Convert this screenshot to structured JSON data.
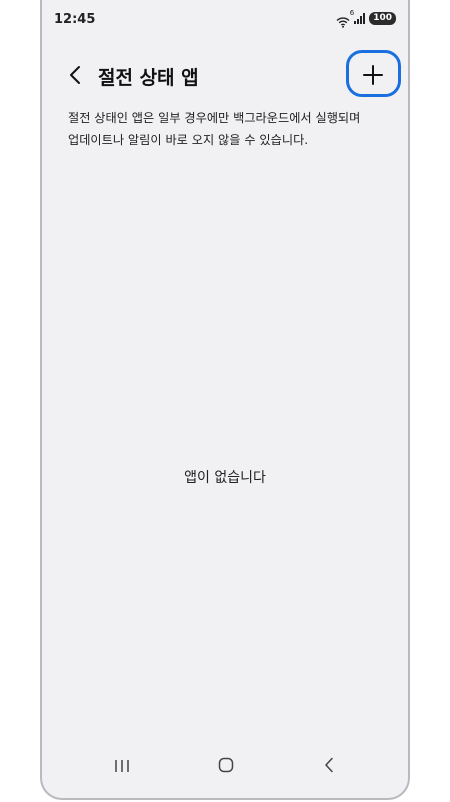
{
  "status_bar": {
    "time": "12:45",
    "wifi_label": "6",
    "battery": "100",
    "icons": [
      "wifi-icon",
      "signal-icon",
      "battery-icon"
    ]
  },
  "app_bar": {
    "title": "절전 상태 앱",
    "back_icon": "chevron-left-icon",
    "add_icon": "plus-icon",
    "highlight_color": "#1a6fe0"
  },
  "description": {
    "line1": "절전 상태인 앱은 일부 경우에만 백그라운드에서 실행되며",
    "line2": "업데이트나 알림이 바로 오지 않을 수 있습니다."
  },
  "empty_state": {
    "message": "앱이 없습니다"
  },
  "nav_bar": {
    "icons": [
      "recent-apps-icon",
      "home-icon",
      "back-icon"
    ]
  },
  "colors": {
    "background": "#f1f1f3",
    "text": "#111111",
    "accent": "#1a6fe0"
  }
}
